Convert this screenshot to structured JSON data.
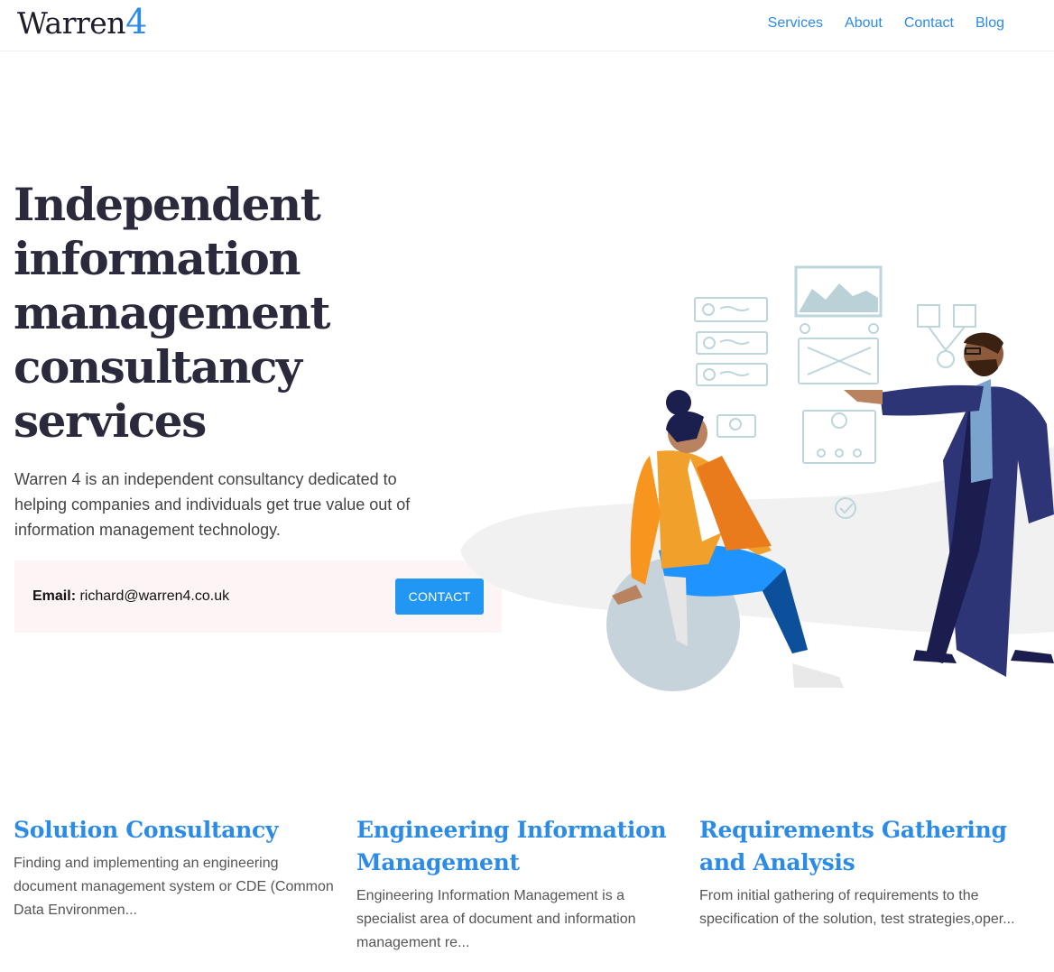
{
  "header": {
    "logo_text": "Warren",
    "logo_number": "4",
    "nav": [
      "Services",
      "About",
      "Contact",
      "Blog"
    ]
  },
  "hero": {
    "title": "Independent information management consultancy services",
    "subtitle": "Warren 4 is an independent consultancy dedicated to helping companies and individuals get true value out of information management technology.",
    "email_label": "Email:",
    "email_value": "richard@warren4.co.uk",
    "contact_button": "CONTACT"
  },
  "services": [
    {
      "title": "Solution Consultancy",
      "text": "Finding and implementing an engineering document management system or CDE (Common Data Environmen..."
    },
    {
      "title": "Engineering Information Management",
      "text": "Engineering Information Management is a specialist area of document and information management re..."
    },
    {
      "title": "Requirements Gathering and Analysis",
      "text": "From initial gathering of requirements to the specification of the solution, test strategies,oper..."
    }
  ],
  "colors": {
    "accent": "#2b8be6",
    "button": "#2196f3",
    "title": "#2a2a3c",
    "contact_bg": "#fdf5f5"
  }
}
